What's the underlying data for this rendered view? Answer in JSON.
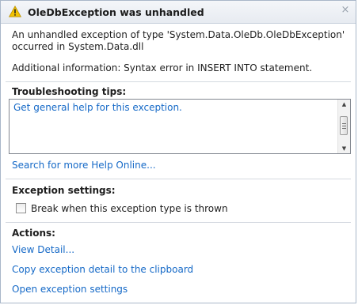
{
  "dialog": {
    "title": "OleDbException was unhandled",
    "message": "An unhandled exception of type 'System.Data.OleDb.OleDbException' occurred in System.Data.dll",
    "additional_info": "Additional information: Syntax error in INSERT INTO statement.",
    "close_glyph": "×"
  },
  "troubleshooting": {
    "header": "Troubleshooting tips:",
    "tips": [
      "Get general help for this exception."
    ],
    "search_link": "Search for more Help Online..."
  },
  "exception_settings": {
    "header": "Exception settings:",
    "checkbox_label": "Break when this exception type is thrown",
    "checked": false
  },
  "actions": {
    "header": "Actions:",
    "links": [
      "View Detail...",
      "Copy exception detail to the clipboard",
      "Open exception settings"
    ]
  },
  "icons": {
    "warning": "warning-icon",
    "close": "close-icon",
    "scroll_up": "scroll-up-icon",
    "scroll_down": "scroll-down-icon"
  },
  "colors": {
    "link": "#1569c7",
    "warning_fill": "#f2c200",
    "border": "#a9b7c9"
  }
}
